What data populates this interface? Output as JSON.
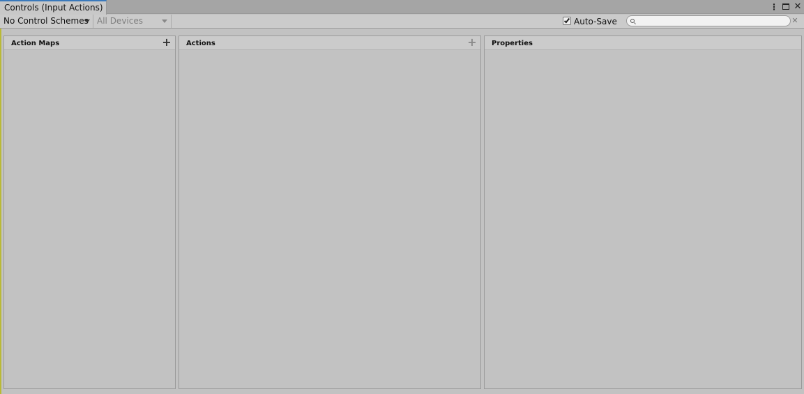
{
  "window": {
    "tab_title": "Controls (Input Actions)",
    "menu_icon": "kebab-menu-icon",
    "maximize_icon": "maximize-icon",
    "close_icon": "close-icon",
    "close_glyph": "✕"
  },
  "toolbar": {
    "control_scheme": "No Control Schemes",
    "devices": "All Devices",
    "autosave_label": "Auto-Save",
    "autosave_checked": true,
    "search_value": "",
    "search_placeholder": "",
    "clear_glyph": "✕"
  },
  "panels": {
    "action_maps": {
      "title": "Action Maps",
      "add_glyph": "+"
    },
    "actions": {
      "title": "Actions",
      "add_glyph": "+"
    },
    "properties": {
      "title": "Properties"
    }
  },
  "colors": {
    "tab_accent": "#3a79bb",
    "panel_bg": "#c2c2c2",
    "header_bg": "#cbcbcb",
    "left_accent": "#b9b936"
  }
}
